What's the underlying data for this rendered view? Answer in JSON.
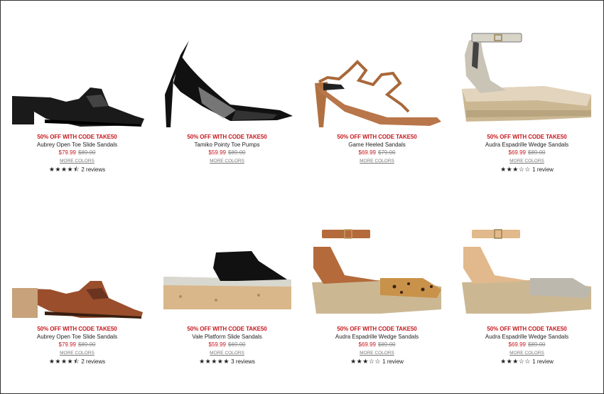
{
  "products": [
    {
      "promo": "50% OFF WITH CODE TAKE50",
      "name": "Aubrey Open Toe Slide Sandals",
      "sale": "$79.99",
      "orig": "$89.00",
      "more": "MORE COLORS",
      "stars": "★★★★⯪",
      "reviews": "2 reviews",
      "rating": 4.5
    },
    {
      "promo": "50% OFF WITH CODE TAKE50",
      "name": "Tamiko Pointy Toe Pumps",
      "sale": "$59.99",
      "orig": "$89.00",
      "more": "MORE COLORS",
      "stars": "",
      "reviews": "",
      "rating": null
    },
    {
      "promo": "50% OFF WITH CODE TAKE50",
      "name": "Game Heeled Sandals",
      "sale": "$69.99",
      "orig": "$79.00",
      "more": "MORE COLORS",
      "stars": "",
      "reviews": "",
      "rating": null
    },
    {
      "promo": "50% OFF WITH CODE TAKE50",
      "name": "Audra Espadrille Wedge Sandals",
      "sale": "$69.99",
      "orig": "$89.00",
      "more": "MORE COLORS",
      "stars": "★★★☆☆",
      "reviews": "1 review",
      "rating": 3
    },
    {
      "promo": "50% OFF WITH CODE TAKE50",
      "name": "Aubrey Open Toe Slide Sandals",
      "sale": "$79.99",
      "orig": "$89.00",
      "more": "MORE COLORS",
      "stars": "★★★★⯪",
      "reviews": "2 reviews",
      "rating": 4.5
    },
    {
      "promo": "50% OFF WITH CODE TAKE50",
      "name": "Vale Platform Slide Sandals",
      "sale": "$59.99",
      "orig": "$69.00",
      "more": "MORE COLORS",
      "stars": "★★★★★",
      "reviews": "3 reviews",
      "rating": 5
    },
    {
      "promo": "50% OFF WITH CODE TAKE50",
      "name": "Audra Espadrille Wedge Sandals",
      "sale": "$69.99",
      "orig": "$89.00",
      "more": "MORE COLORS",
      "stars": "★★★☆☆",
      "reviews": "1 review",
      "rating": 3
    },
    {
      "promo": "50% OFF WITH CODE TAKE50",
      "name": "Audra Espadrille Wedge Sandals",
      "sale": "$69.99",
      "orig": "$89.00",
      "more": "MORE COLORS",
      "stars": "★★★☆☆",
      "reviews": "1 review",
      "rating": 3
    }
  ],
  "colors": {
    "promo": "#c6191f",
    "sale": "#c6191f",
    "orig": "#888888"
  }
}
